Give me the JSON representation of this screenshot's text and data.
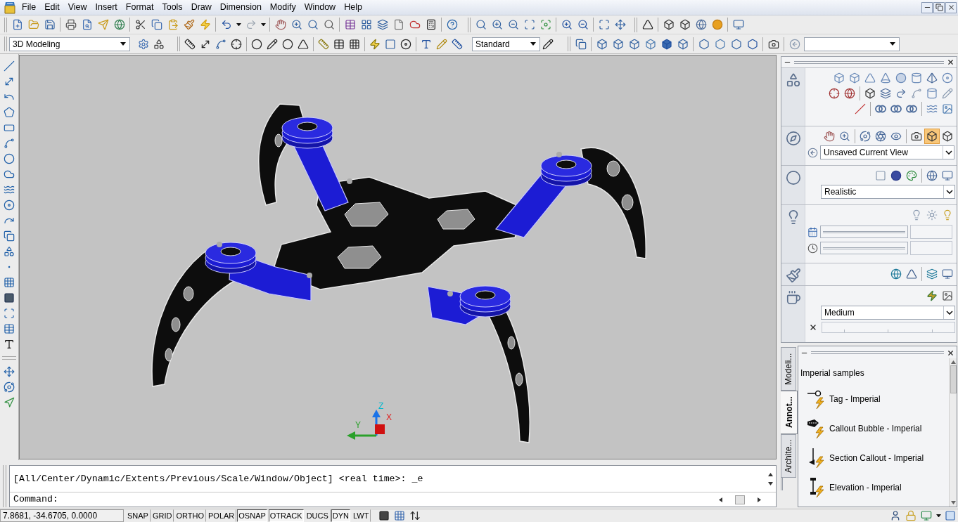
{
  "app_window": {
    "menu": [
      "File",
      "Edit",
      "View",
      "Insert",
      "Format",
      "Tools",
      "Draw",
      "Dimension",
      "Modify",
      "Window",
      "Help"
    ]
  },
  "toolbars": {
    "workspace": {
      "value": "3D Modeling"
    },
    "text_style": {
      "value": "Standard"
    }
  },
  "viewport": {
    "axis_labels": [
      "Z",
      "Y",
      "X"
    ]
  },
  "command_line": {
    "history": "[All/Center/Dynamic/Extents/Previous/Scale/Window/Object] <real time>: _e",
    "prompt": "Command:"
  },
  "dashboard": {
    "perspective_button": {
      "on": true
    },
    "view": {
      "value": "Unsaved Current View"
    },
    "visual_style": {
      "value": "Realistic"
    },
    "render_preset": {
      "value": "Medium"
    }
  },
  "tool_palette": {
    "tabs": [
      {
        "label": "Modeli...",
        "selected": false
      },
      {
        "label": "Annot...",
        "selected": true
      },
      {
        "label": "Archite...",
        "selected": false
      }
    ],
    "heading": "Imperial samples",
    "items": [
      {
        "label": "Tag - Imperial"
      },
      {
        "label": "Callout Bubble - Imperial"
      },
      {
        "label": "Section Callout - Imperial"
      },
      {
        "label": "Elevation - Imperial"
      }
    ]
  },
  "status_bar": {
    "coordinates": "7.8681, -34.6705, 0.0000",
    "toggles": [
      {
        "label": "SNAP",
        "on": false
      },
      {
        "label": "GRID",
        "on": false
      },
      {
        "label": "ORTHO",
        "on": false
      },
      {
        "label": "POLAR",
        "on": false
      },
      {
        "label": "OSNAP",
        "on": true
      },
      {
        "label": "OTRACK",
        "on": true
      },
      {
        "label": "DUCS",
        "on": false
      },
      {
        "label": "DYN",
        "on": true
      },
      {
        "label": "LWT",
        "on": false
      }
    ]
  }
}
